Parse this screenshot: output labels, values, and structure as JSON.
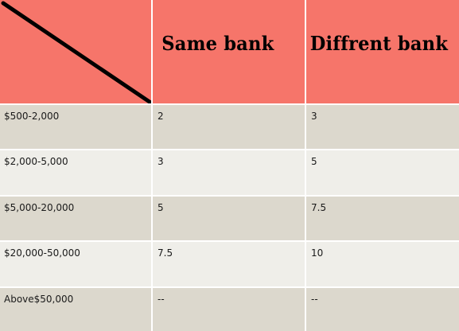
{
  "table": {
    "headers": [
      "Same bank",
      "Diffrent bank"
    ],
    "rows": [
      {
        "range": "$500-2,000",
        "same_bank": "2",
        "different_bank": "3"
      },
      {
        "range": "$2,000-5,000",
        "same_bank": "3",
        "different_bank": "5"
      },
      {
        "range": "$5,000-20,000",
        "same_bank": "5",
        "different_bank": "7.5"
      },
      {
        "range": "$20,000-50,000",
        "same_bank": "7.5",
        "different_bank": "10"
      },
      {
        "range": "Above$50,000",
        "same_bank": "--",
        "different_bank": "--"
      }
    ]
  },
  "colors": {
    "header_background": "#f6756a",
    "row_dark": "#dcd8cd",
    "row_light": "#efeee9",
    "diagonal_line": "#000000"
  }
}
